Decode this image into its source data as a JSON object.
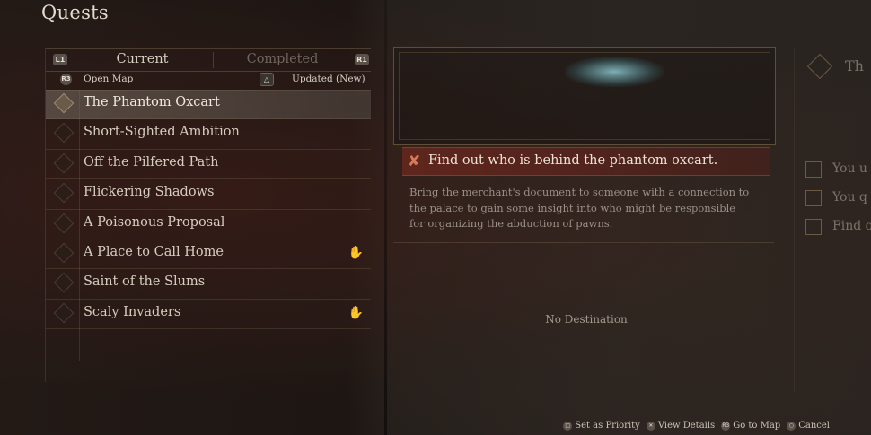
{
  "screen": {
    "title": "Quests"
  },
  "tabs": {
    "left_button": "L1",
    "current": "Current",
    "completed": "Completed",
    "right_button": "R1"
  },
  "subbar": {
    "open_map_button": "R3",
    "open_map_label": "Open Map",
    "sort_button": "△",
    "sort_label": "Updated (New)"
  },
  "quests": [
    {
      "name": "The Phantom Oxcart",
      "selected": true,
      "pawn_icon": false
    },
    {
      "name": "Short-Sighted Ambition",
      "selected": false,
      "pawn_icon": false
    },
    {
      "name": "Off the Pilfered Path",
      "selected": false,
      "pawn_icon": false
    },
    {
      "name": "Flickering Shadows",
      "selected": false,
      "pawn_icon": false
    },
    {
      "name": "A Poisonous Proposal",
      "selected": false,
      "pawn_icon": false
    },
    {
      "name": "A Place to Call Home",
      "selected": false,
      "pawn_icon": true
    },
    {
      "name": "Saint of the Slums",
      "selected": false,
      "pawn_icon": false
    },
    {
      "name": "Scaly Invaders",
      "selected": false,
      "pawn_icon": true
    }
  ],
  "detail": {
    "objective": "Find out who is behind the phantom oxcart.",
    "description": "Bring the merchant's document to someone with a connection to the palace to gain some insight into who might be responsible for organizing the abduction of pawns.",
    "destination": "No Destination"
  },
  "preview": {
    "title": "Th",
    "lines": [
      "You u",
      "You q",
      "Find o"
    ]
  },
  "hints": [
    {
      "icon": "□",
      "label": "Set as Priority"
    },
    {
      "icon": "✕",
      "label": "View Details"
    },
    {
      "icon": "R3",
      "label": "Go to Map"
    },
    {
      "icon": "○",
      "label": "Cancel"
    }
  ],
  "colors": {
    "accent": "#6e2a20",
    "objective_icon": "#d47b57",
    "map_glow": "#8cc8d2"
  }
}
